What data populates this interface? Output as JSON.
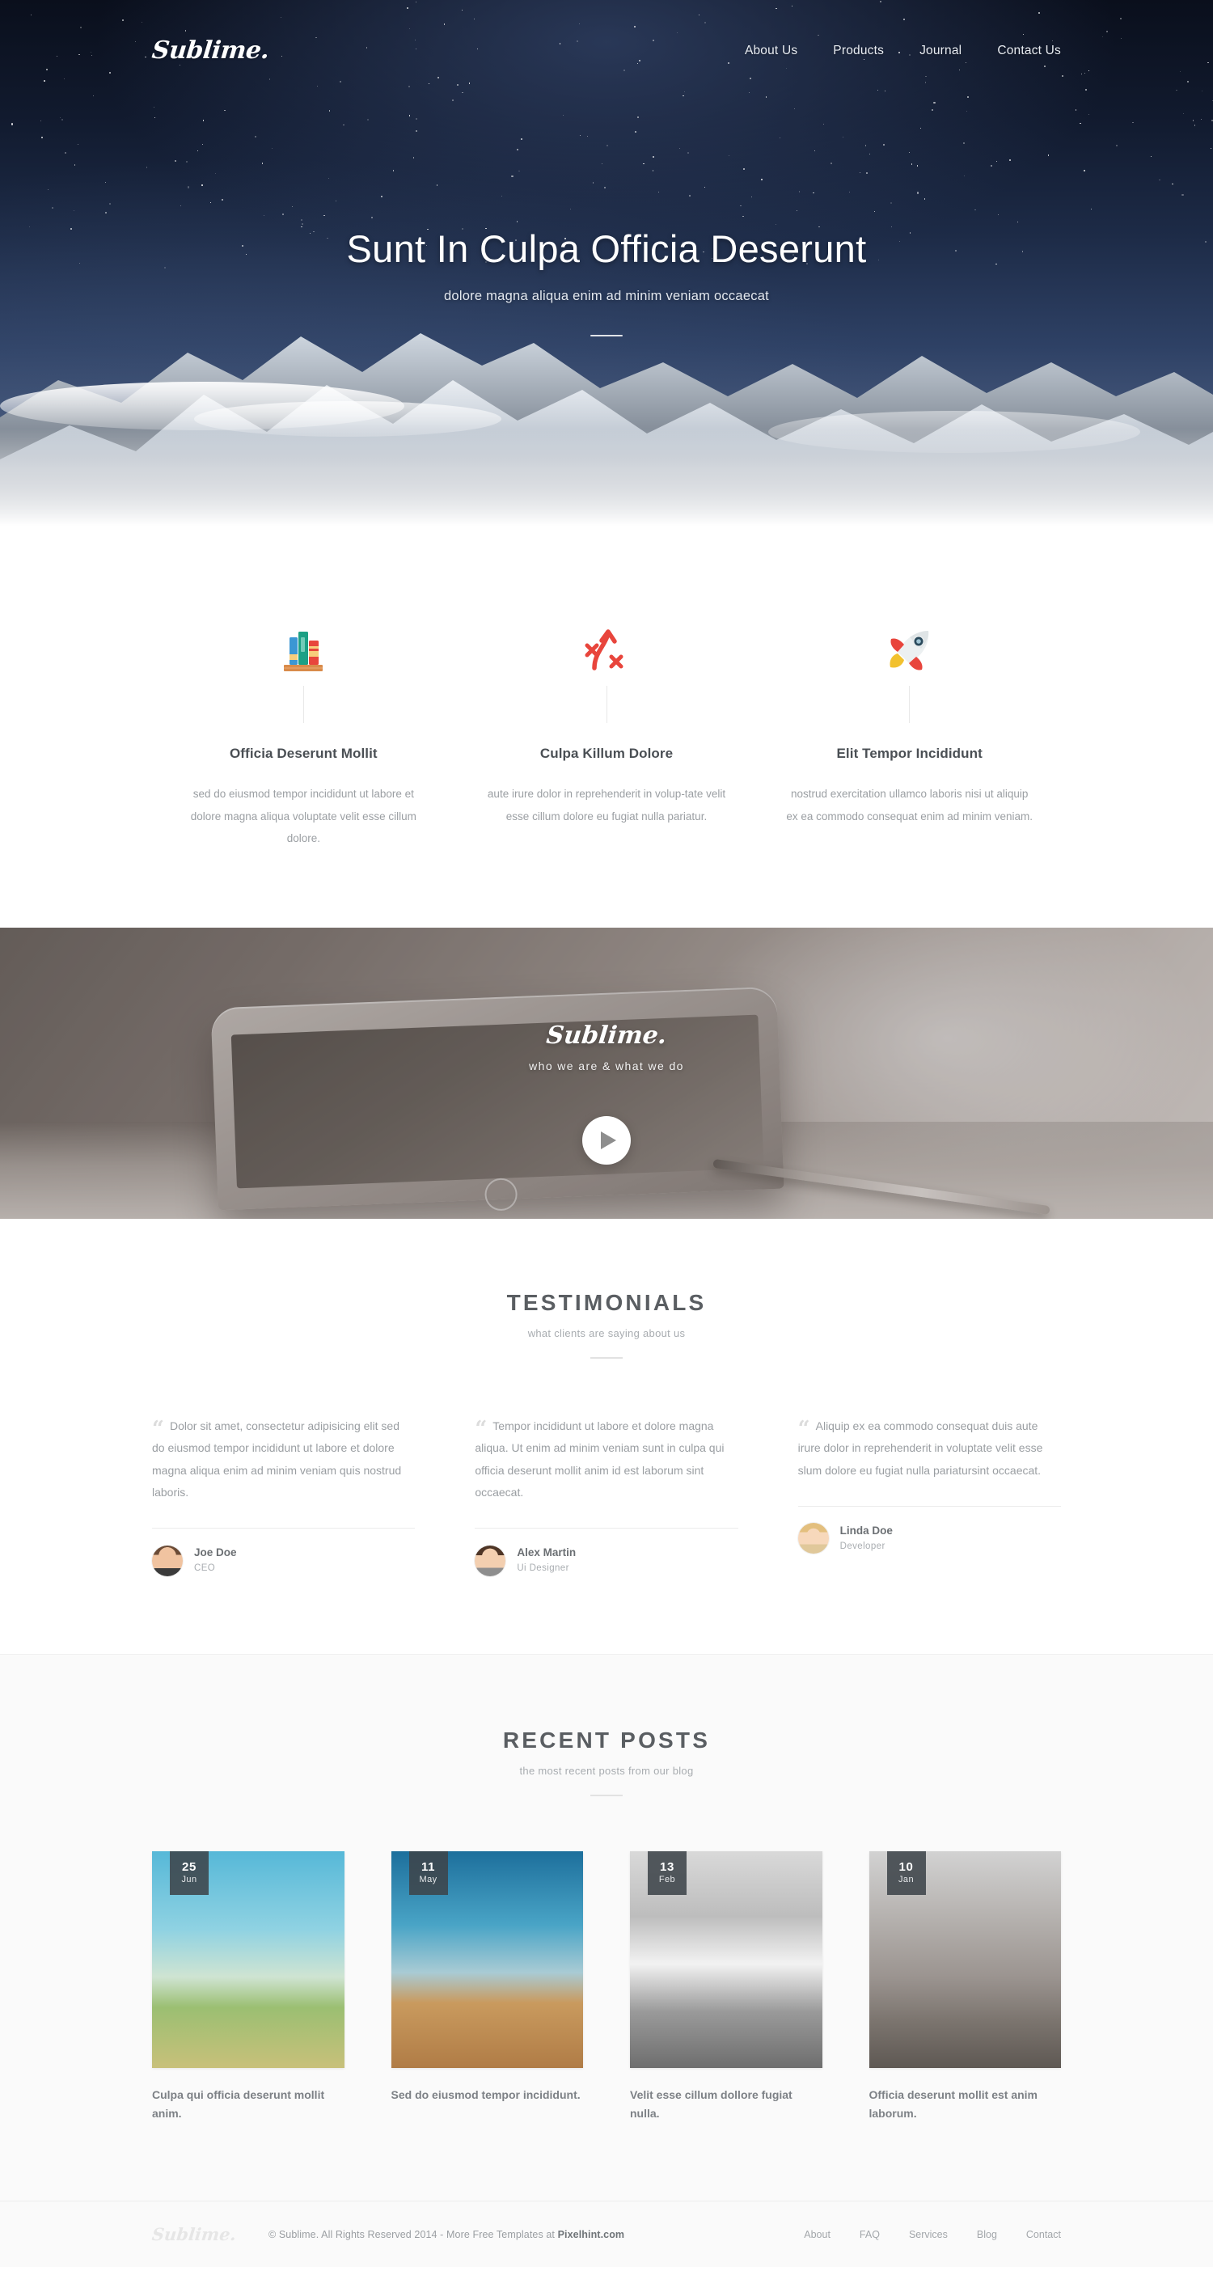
{
  "brand": {
    "name": "Sublime."
  },
  "header": {
    "logo": "Sublime.",
    "nav": [
      {
        "label": "About Us"
      },
      {
        "label": "Products"
      },
      {
        "label": "Journal"
      },
      {
        "label": "Contact Us"
      }
    ]
  },
  "hero": {
    "title": "Sunt In Culpa Officia Deserunt",
    "subtitle": "dolore magna aliqua enim ad minim veniam occaecat"
  },
  "features": [
    {
      "icon": "books-icon",
      "title": "Officia Deserunt Mollit",
      "text": "sed do eiusmod tempor incididunt ut labore et dolore magna aliqua voluptate velit esse cillum dolore."
    },
    {
      "icon": "strategy-arrow-icon",
      "title": "Culpa Killum Dolore",
      "text": "aute irure dolor in reprehenderit in volup-tate velit esse cillum dolore eu fugiat nulla pariatur."
    },
    {
      "icon": "rocket-icon",
      "title": "Elit Tempor Incididunt",
      "text": "nostrud exercitation ullamco laboris nisi ut aliquip ex ea commodo consequat enim ad minim veniam."
    }
  ],
  "video": {
    "logo": "Sublime.",
    "tagline": "who we are & what we do",
    "play_label": "play-button"
  },
  "testimonials": {
    "title": "TESTIMONIALS",
    "subtitle": "what clients are saying about us",
    "items": [
      {
        "quote": "Dolor sit amet, consectetur adipisicing elit sed do eiusmod tempor incididunt ut labore et dolore magna aliqua enim ad minim veniam quis nostrud laboris.",
        "name": "Joe Doe",
        "role": "CEO"
      },
      {
        "quote": "Tempor incididunt ut labore et dolore magna aliqua. Ut enim ad minim veniam sunt in culpa qui officia deserunt mollit anim id est laborum sint occaecat.",
        "name": "Alex Martin",
        "role": "Ui Designer"
      },
      {
        "quote": "Aliquip ex ea commodo consequat duis aute irure dolor in reprehenderit in voluptate velit esse slum dolore eu fugiat nulla pariatursint occaecat.",
        "name": "Linda Doe",
        "role": "Developer"
      }
    ]
  },
  "posts": {
    "title": "RECENT POSTS",
    "subtitle": "the most recent posts from our blog",
    "items": [
      {
        "day": "25",
        "month": "Jun",
        "title": "Culpa qui officia deserunt mollit anim."
      },
      {
        "day": "11",
        "month": "May",
        "title": "Sed do eiusmod tempor incididunt."
      },
      {
        "day": "13",
        "month": "Feb",
        "title": "Velit esse cillum dollore fugiat nulla."
      },
      {
        "day": "10",
        "month": "Jan",
        "title": "Officia deserunt mollit est anim laborum."
      }
    ]
  },
  "footer": {
    "logo": "Sublime.",
    "copyright_prefix": "© Sublime. All Rights Reserved 2014 - More Free Templates at ",
    "copyright_link": "Pixelhint.com",
    "nav": [
      {
        "label": "About"
      },
      {
        "label": "FAQ"
      },
      {
        "label": "Services"
      },
      {
        "label": "Blog"
      },
      {
        "label": "Contact"
      }
    ]
  },
  "colors": {
    "accent_red": "#e8453c",
    "dark_text": "#5a5e62",
    "muted_text": "#9a9ea2",
    "date_badge": "#3d444a",
    "hero_dark": "#0a0f1c"
  }
}
